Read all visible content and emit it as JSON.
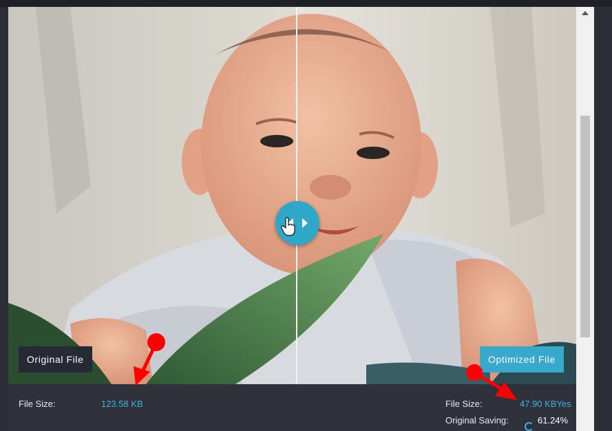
{
  "compare": {
    "original_label": "Original File",
    "optimized_label": "Optimized File",
    "divider_position_percent": 50.8
  },
  "footer": {
    "original_size_label": "File Size:",
    "original_size_value": "123.58 KB",
    "optimized_size_label": "File Size:",
    "optimized_size_value": "47.90 KBYes",
    "saving_label": "Original Saving:",
    "saving_value": "61.24%"
  },
  "icons": {
    "handle": "compare-slider-handle-icon",
    "cursor": "hand-pointer-icon",
    "saving": "spinner-icon",
    "annotation": "red-arrow-annotation"
  },
  "colors": {
    "accent": "#36a9cc",
    "value_text": "#3fb3dc",
    "annotation": "#ff0000",
    "panel": "#2f323b"
  }
}
